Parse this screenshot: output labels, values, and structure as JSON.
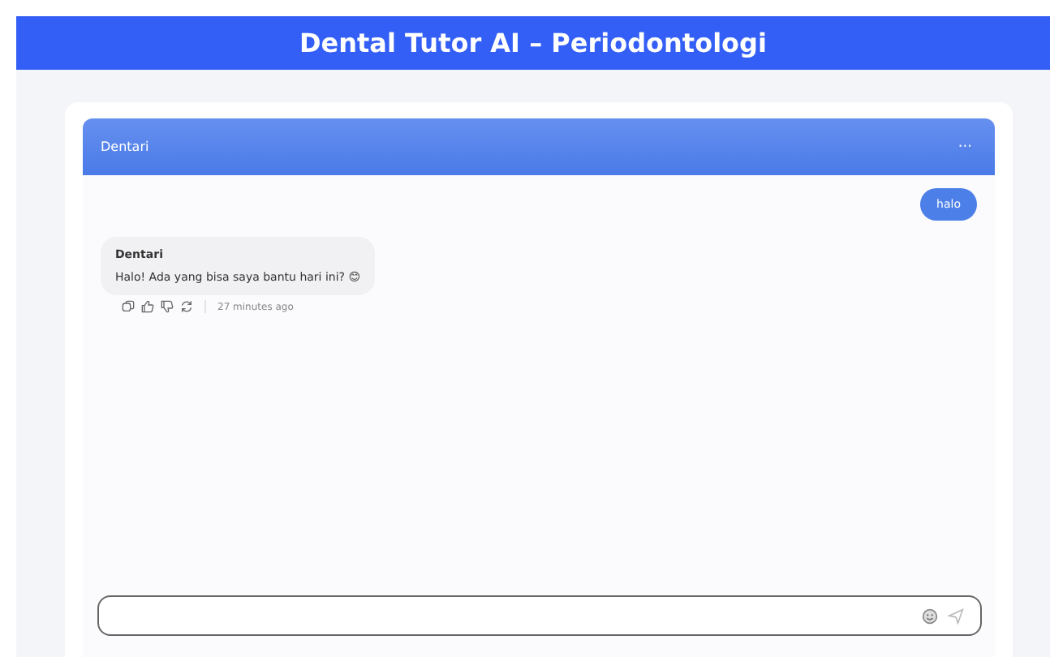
{
  "app_title": "Dental Tutor AI – Periodontologi",
  "chat": {
    "title": "Dentari",
    "menu": "···",
    "messages": [
      {
        "kind": "user",
        "text": "halo"
      },
      {
        "kind": "bot",
        "sender": "Dentari",
        "text": "Halo! Ada yang bisa saya bantu hari ini? 😊",
        "time": "27 minutes ago"
      }
    ]
  }
}
